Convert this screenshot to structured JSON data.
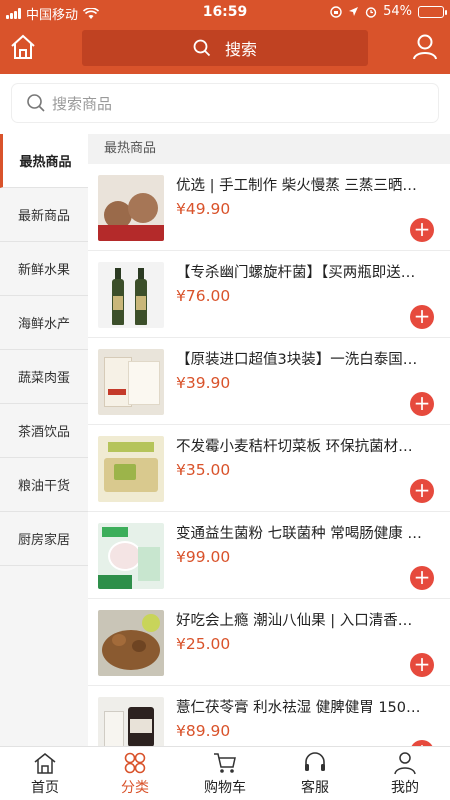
{
  "status": {
    "carrier": "中国移动",
    "time": "16:59",
    "battery": "54%",
    "battery_fill": 0.54
  },
  "header": {
    "search_label": "搜索"
  },
  "search": {
    "placeholder": "搜索商品"
  },
  "sidebar": {
    "items": [
      {
        "label": "最热商品",
        "active": true
      },
      {
        "label": "最新商品"
      },
      {
        "label": "新鲜水果"
      },
      {
        "label": "海鲜水产"
      },
      {
        "label": "蔬菜肉蛋"
      },
      {
        "label": "茶酒饮品"
      },
      {
        "label": "粮油干货"
      },
      {
        "label": "厨房家居"
      }
    ]
  },
  "content": {
    "section_title": "最热商品",
    "products": [
      {
        "title": "优选 | 手工制作 柴火慢蒸 三蒸三晒…",
        "price": "¥49.90"
      },
      {
        "title": "【专杀幽门螺旋杆菌】【买两瓶即送…",
        "price": "¥76.00"
      },
      {
        "title": "【原装进口超值3块装】一洗白泰国…",
        "price": "¥39.90"
      },
      {
        "title": "不发霉小麦秸杆切菜板 环保抗菌材…",
        "price": "¥35.00"
      },
      {
        "title": "变通益生菌粉 七联菌种 常喝肠健康 …",
        "price": "¥99.00"
      },
      {
        "title": "好吃会上瘾 潮汕八仙果 | 入口清香…",
        "price": "¥25.00"
      },
      {
        "title": "薏仁茯苓膏 利水祛湿 健脾健胃 150…",
        "price": "¥89.90"
      }
    ]
  },
  "tabbar": {
    "items": [
      {
        "label": "首页"
      },
      {
        "label": "分类",
        "active": true
      },
      {
        "label": "购物车"
      },
      {
        "label": "客服"
      },
      {
        "label": "我的"
      }
    ]
  },
  "colors": {
    "brand": "#d9532b",
    "price": "#d9532b",
    "add_button": "#e64a3d"
  }
}
